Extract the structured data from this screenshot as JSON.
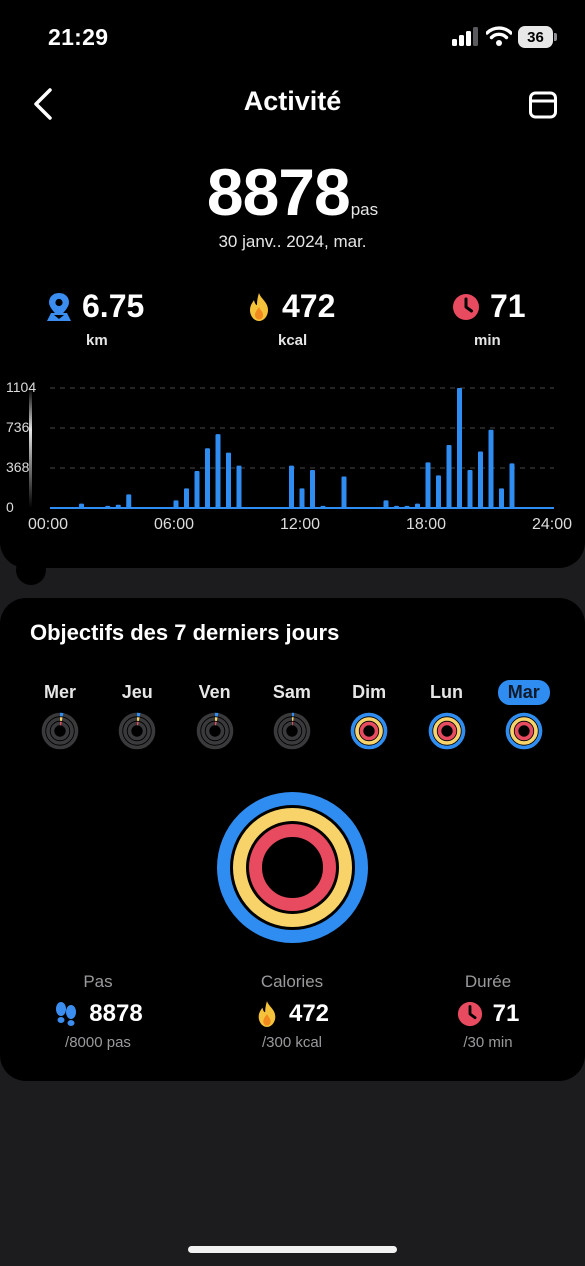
{
  "status_bar": {
    "time": "21:29",
    "battery": "36"
  },
  "header": {
    "title": "Activité"
  },
  "summary": {
    "steps": "8878",
    "steps_unit": "pas",
    "date": "30 janv.. 2024, mar."
  },
  "stats": [
    {
      "value": "6.75",
      "label": "km",
      "icon": "location-pin-icon",
      "color": "#3b8ef0"
    },
    {
      "value": "472",
      "label": "kcal",
      "icon": "flame-icon",
      "color": "#f5c33b"
    },
    {
      "value": "71",
      "label": "min",
      "icon": "clock-icon",
      "color": "#e84a5f"
    }
  ],
  "chart_data": {
    "type": "bar",
    "x_unit": "hour",
    "x": [
      1.5,
      2.75,
      3.25,
      3.75,
      6,
      6.5,
      7,
      7.5,
      8,
      8.5,
      9,
      11.5,
      12,
      12.5,
      13,
      14,
      16,
      16.5,
      17,
      17.5,
      18,
      18.5,
      19,
      19.5,
      20,
      20.5,
      21,
      21.5,
      22,
      22.5
    ],
    "values": [
      40,
      20,
      30,
      125,
      70,
      180,
      340,
      550,
      680,
      510,
      390,
      390,
      180,
      350,
      20,
      290,
      70,
      20,
      20,
      40,
      420,
      300,
      580,
      1104,
      350,
      520,
      720,
      180,
      410,
      0
    ],
    "xticks": [
      "00:00",
      "06:00",
      "12:00",
      "18:00",
      "24:00"
    ],
    "xlim": [
      0,
      24
    ],
    "yticks": [
      "0",
      "368",
      "736",
      "1104"
    ],
    "ylim": [
      0,
      1104
    ],
    "grid": true,
    "bar_color": "#2f8cf0"
  },
  "goals": {
    "title": "Objectifs des 7 derniers jours",
    "days": [
      {
        "label": "Mer",
        "steps": 0.03,
        "calories": 0.03,
        "duration": 0.03,
        "selected": false
      },
      {
        "label": "Jeu",
        "steps": 0.03,
        "calories": 0.03,
        "duration": 0.03,
        "selected": false
      },
      {
        "label": "Ven",
        "steps": 0.03,
        "calories": 0.03,
        "duration": 0.03,
        "selected": false
      },
      {
        "label": "Sam",
        "steps": 0.02,
        "calories": 0.02,
        "duration": 0.02,
        "selected": false
      },
      {
        "label": "Dim",
        "steps": 1,
        "calories": 1,
        "duration": 1,
        "selected": false
      },
      {
        "label": "Lun",
        "steps": 1,
        "calories": 1,
        "duration": 1,
        "selected": false
      },
      {
        "label": "Mar",
        "steps": 1,
        "calories": 1,
        "duration": 1,
        "selected": true
      }
    ],
    "ring_colors": {
      "steps": "#2f8cf0",
      "calories": "#f7d36a",
      "duration": "#e84a5f"
    },
    "totals": [
      {
        "name": "Pas",
        "value": "8878",
        "target": "/8000 pas",
        "icon": "footprints-icon",
        "color": "#3b8ef0"
      },
      {
        "name": "Calories",
        "value": "472",
        "target": "/300 kcal",
        "icon": "flame-icon",
        "color": "#f5c33b"
      },
      {
        "name": "Durée",
        "value": "71",
        "target": "/30 min",
        "icon": "clock-icon",
        "color": "#e84a5f"
      }
    ]
  }
}
